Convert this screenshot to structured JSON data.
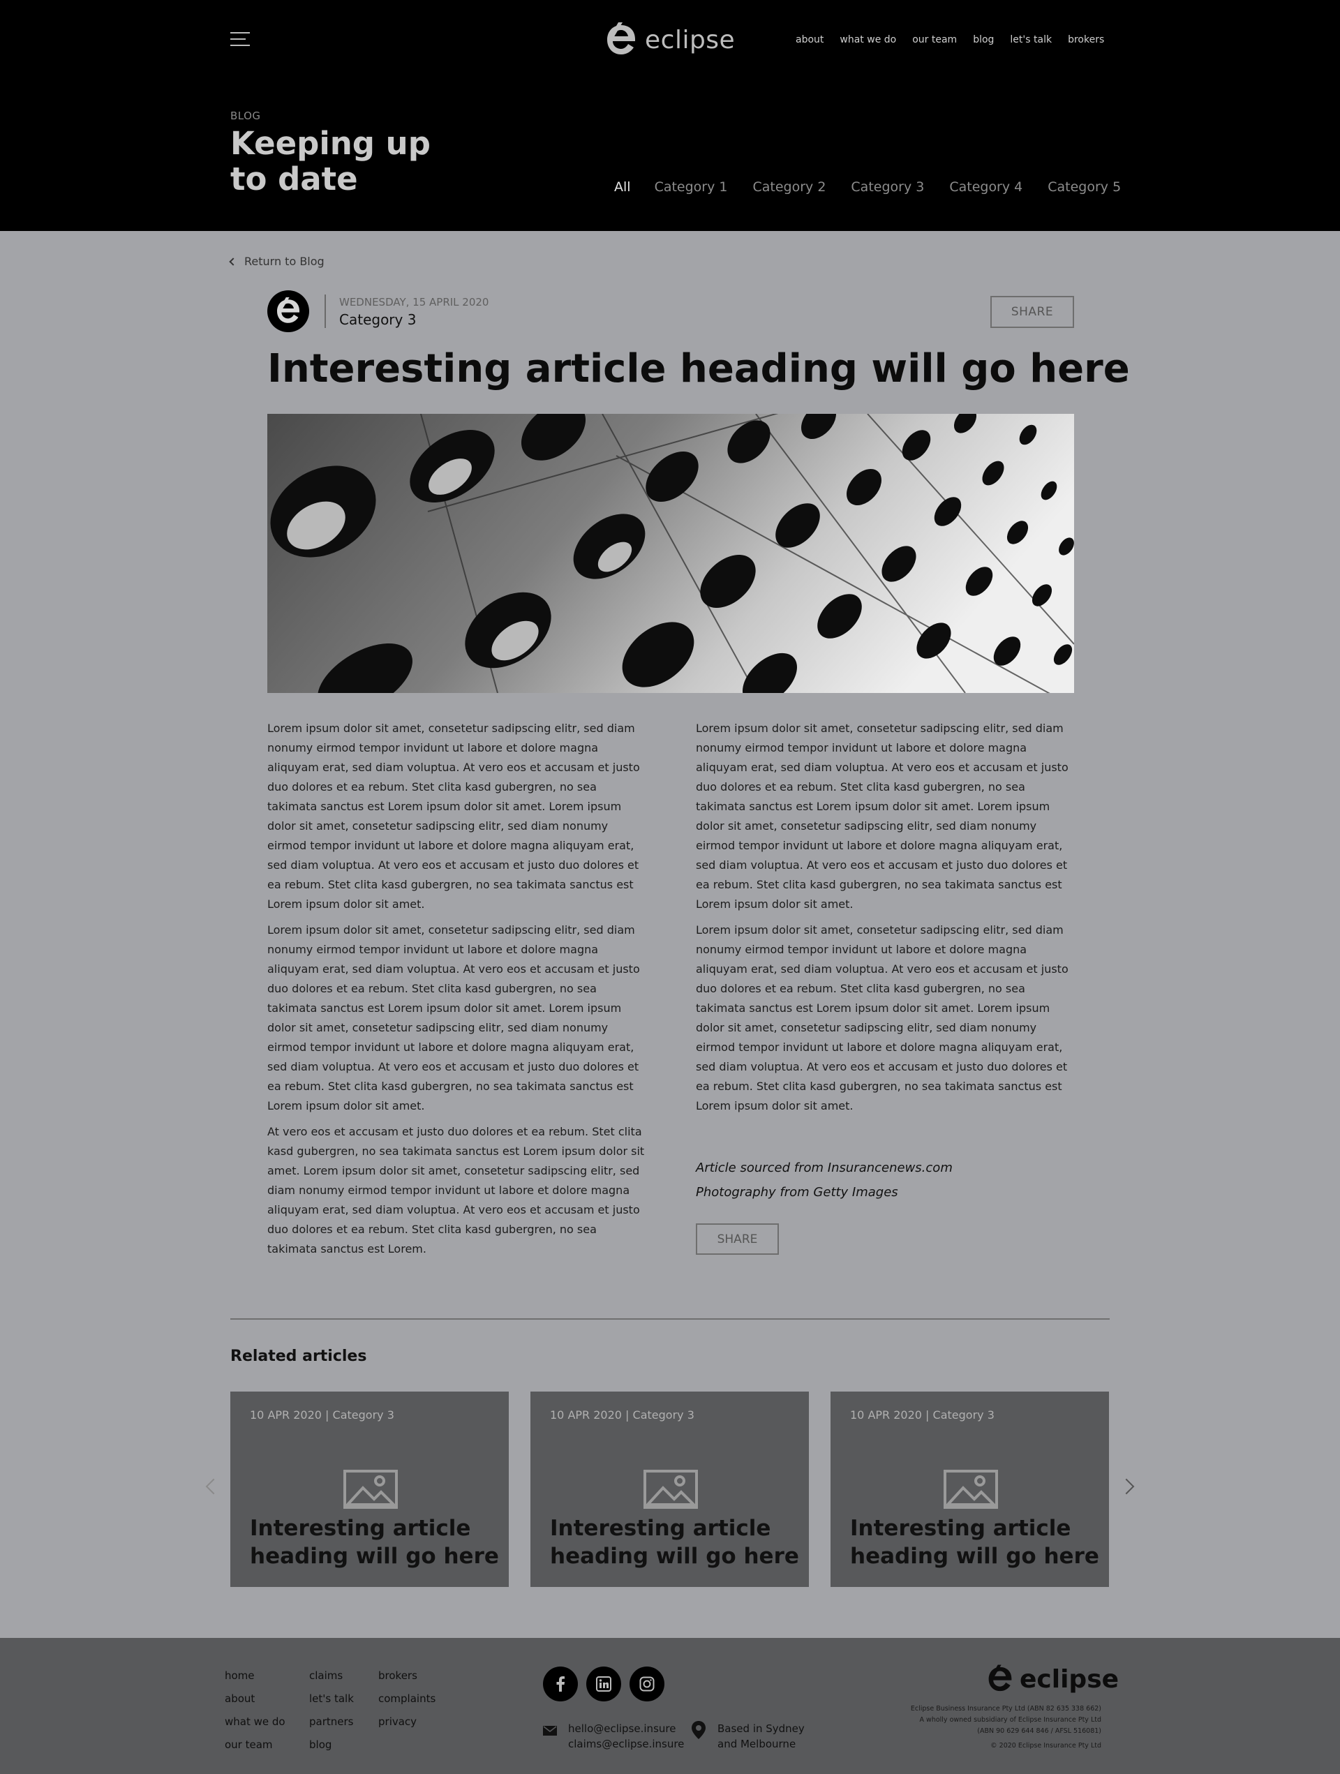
{
  "header": {
    "brand": "eclipse",
    "nav": [
      "about",
      "what we do",
      "our team",
      "blog",
      "let's talk",
      "brokers"
    ],
    "eyebrow": "BLOG",
    "title": "Keeping up to date",
    "categories": [
      "All",
      "Category 1",
      "Category 2",
      "Category 3",
      "Category 4",
      "Category 5"
    ]
  },
  "article": {
    "back_label": "Return to Blog",
    "date": "WEDNESDAY, 15 APRIL 2020",
    "category": "Category 3",
    "share_label": "SHARE",
    "title": "Interesting article heading will go here",
    "left_paragraphs": [
      "Lorem ipsum dolor sit amet, consetetur sadipscing elitr, sed diam nonumy eirmod tempor invidunt ut labore et dolore magna aliquyam erat, sed diam voluptua. At vero eos et accusam et justo duo dolores et ea rebum. Stet clita kasd gubergren, no sea takimata sanctus est Lorem ipsum dolor sit amet. Lorem ipsum dolor sit amet, consetetur sadipscing elitr, sed diam nonumy eirmod tempor invidunt ut labore et dolore magna aliquyam erat, sed diam voluptua. At vero eos et accusam et justo duo dolores et ea rebum. Stet clita kasd gubergren, no sea takimata sanctus est Lorem ipsum dolor sit amet.",
      "Lorem ipsum dolor sit amet, consetetur sadipscing elitr, sed diam nonumy eirmod tempor invidunt ut labore et dolore magna aliquyam erat, sed diam voluptua. At vero eos et accusam et justo duo dolores et ea rebum. Stet clita kasd gubergren, no sea takimata sanctus est Lorem ipsum dolor sit amet. Lorem ipsum dolor sit amet, consetetur sadipscing elitr, sed diam nonumy eirmod tempor invidunt ut labore et dolore magna aliquyam erat, sed diam voluptua. At vero eos et accusam et justo duo dolores et ea rebum. Stet clita kasd gubergren, no sea takimata sanctus est Lorem ipsum dolor sit amet.",
      "At vero eos et accusam et justo duo dolores et ea rebum. Stet clita kasd gubergren, no sea takimata sanctus est Lorem ipsum dolor sit amet. Lorem ipsum dolor sit amet, consetetur sadipscing elitr, sed diam nonumy eirmod tempor invidunt ut labore et dolore magna aliquyam erat, sed diam voluptua. At vero eos et accusam et justo duo dolores et ea rebum. Stet clita kasd gubergren, no sea takimata sanctus est Lorem."
    ],
    "right_paragraphs": [
      "Lorem ipsum dolor sit amet, consetetur sadipscing elitr, sed diam nonumy eirmod tempor invidunt ut labore et dolore magna aliquyam erat, sed diam voluptua. At vero eos et accusam et justo duo dolores et ea rebum. Stet clita kasd gubergren, no sea takimata sanctus est Lorem ipsum dolor sit amet. Lorem ipsum dolor sit amet, consetetur sadipscing elitr, sed diam nonumy eirmod tempor invidunt ut labore et dolore magna aliquyam erat, sed diam voluptua. At vero eos et accusam et justo duo dolores et ea rebum. Stet clita kasd gubergren, no sea takimata sanctus est Lorem ipsum dolor sit amet.",
      "Lorem ipsum dolor sit amet, consetetur sadipscing elitr, sed diam nonumy eirmod tempor invidunt ut labore et dolore magna aliquyam erat, sed diam voluptua. At vero eos et accusam et justo duo dolores et ea rebum. Stet clita kasd gubergren, no sea takimata sanctus est Lorem ipsum dolor sit amet. Lorem ipsum dolor sit amet, consetetur sadipscing elitr, sed diam nonumy eirmod tempor invidunt ut labore et dolore magna aliquyam erat, sed diam voluptua. At vero eos et accusam et justo duo dolores et ea rebum. Stet clita kasd gubergren, no sea takimata sanctus est Lorem ipsum dolor sit amet."
    ],
    "credit_source": "Article sourced from Insurancenews.com",
    "credit_photo": "Photography from Getty Images"
  },
  "related": {
    "title": "Related articles",
    "cards": [
      {
        "date": "10 APR 2020",
        "category": "Category 3",
        "title": "Interesting article heading will go here"
      },
      {
        "date": "10 APR 2020",
        "category": "Category 3",
        "title": "Interesting article heading will go here"
      },
      {
        "date": "10 APR 2020",
        "category": "Category 3",
        "title": "Interesting article heading will go here"
      }
    ]
  },
  "footer": {
    "col1": [
      "home",
      "about",
      "what we do",
      "our team"
    ],
    "col2": [
      "claims",
      "let's talk",
      "partners",
      "blog"
    ],
    "col3": [
      "brokers",
      "complaints",
      "privacy"
    ],
    "social": [
      "facebook-icon",
      "linkedin-icon",
      "instagram-icon"
    ],
    "emails": [
      "hello@eclipse.insure",
      "claims@eclipse.insure"
    ],
    "location": [
      "Based in Sydney",
      "and Melbourne"
    ],
    "brand": "eclipse",
    "legal": [
      "Eclipse Business Insurance Pty Ltd (ABN 82 635 338 662)",
      "A wholly owned subsidiary of Eclipse Insurance Pty Ltd",
      "(ABN 90 629 644 846 / AFSL 516081)",
      "© 2020 Eclipse Insurance Pty Ltd"
    ]
  },
  "colors": {
    "header_bg": "#000000",
    "page_bg": "#a3a4a8",
    "card_bg": "#58595b",
    "footer_bg": "#58595b"
  }
}
